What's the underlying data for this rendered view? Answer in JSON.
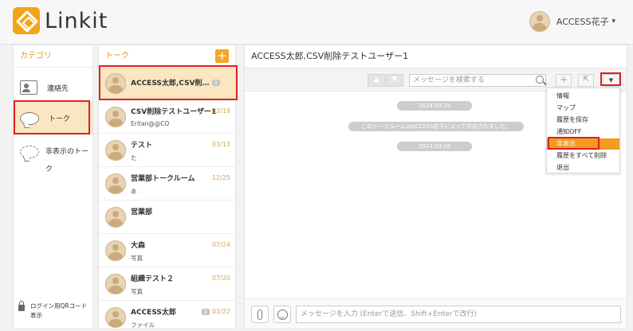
{
  "header": {
    "app_name": "Linkit",
    "user_name": "ACCESS花子",
    "caret": "▾"
  },
  "categories": {
    "title": "カテゴリ",
    "items": [
      {
        "label": "連絡先",
        "icon": "contacts-icon"
      },
      {
        "label": "トーク",
        "icon": "chat-bubble-icon"
      },
      {
        "label": "非表示のトーク",
        "icon": "hidden-chat-icon"
      }
    ],
    "footer_label": "ログイン用QRコード表示"
  },
  "talks": {
    "title": "トーク",
    "add_label": "+",
    "items": [
      {
        "name": "ACCESS太郎,CSV削…",
        "badge": "3",
        "sub": "",
        "date": ""
      },
      {
        "name": "CSV削除テストユーザー1",
        "sub": "Eritan@@CO",
        "date": "03/19"
      },
      {
        "name": "テスト",
        "sub": "た",
        "date": "03/13"
      },
      {
        "name": "営業部トークルーム",
        "sub": "あ",
        "date": "12/25"
      },
      {
        "name": "営業部",
        "sub": "",
        "date": ""
      },
      {
        "name": "大森",
        "sub": "写真",
        "date": "07/24"
      },
      {
        "name": "組織テスト２",
        "sub": "写真",
        "date": "07/20"
      },
      {
        "name": "ACCESS太郎",
        "badge": "2",
        "sub": "ファイル",
        "date": "03/22"
      }
    ]
  },
  "room": {
    "title": "ACCESS太郎,CSV削除テストユーザー1",
    "search_placeholder": "メッセージを検索する",
    "up_label": "▲",
    "down_label": "▼",
    "plus_label": "+",
    "resize_label": "⇱",
    "menu_label": "▼",
    "timeline": [
      "2024.03.25",
      "このトークルームはACCESS花子によって作成されました。",
      "2024.03.26"
    ],
    "dropdown": [
      "情報",
      "マップ",
      "履歴を保存",
      "通知OFF",
      "非表示",
      "履歴をすべて削除",
      "退出"
    ],
    "dropdown_active_index": 4,
    "input_placeholder": "メッセージを入力 (Enterで送信、Shift+Enterで改行)"
  },
  "colors": {
    "accent": "#f5a623",
    "highlight": "#fbe6c2",
    "annotation": "#e02020"
  }
}
